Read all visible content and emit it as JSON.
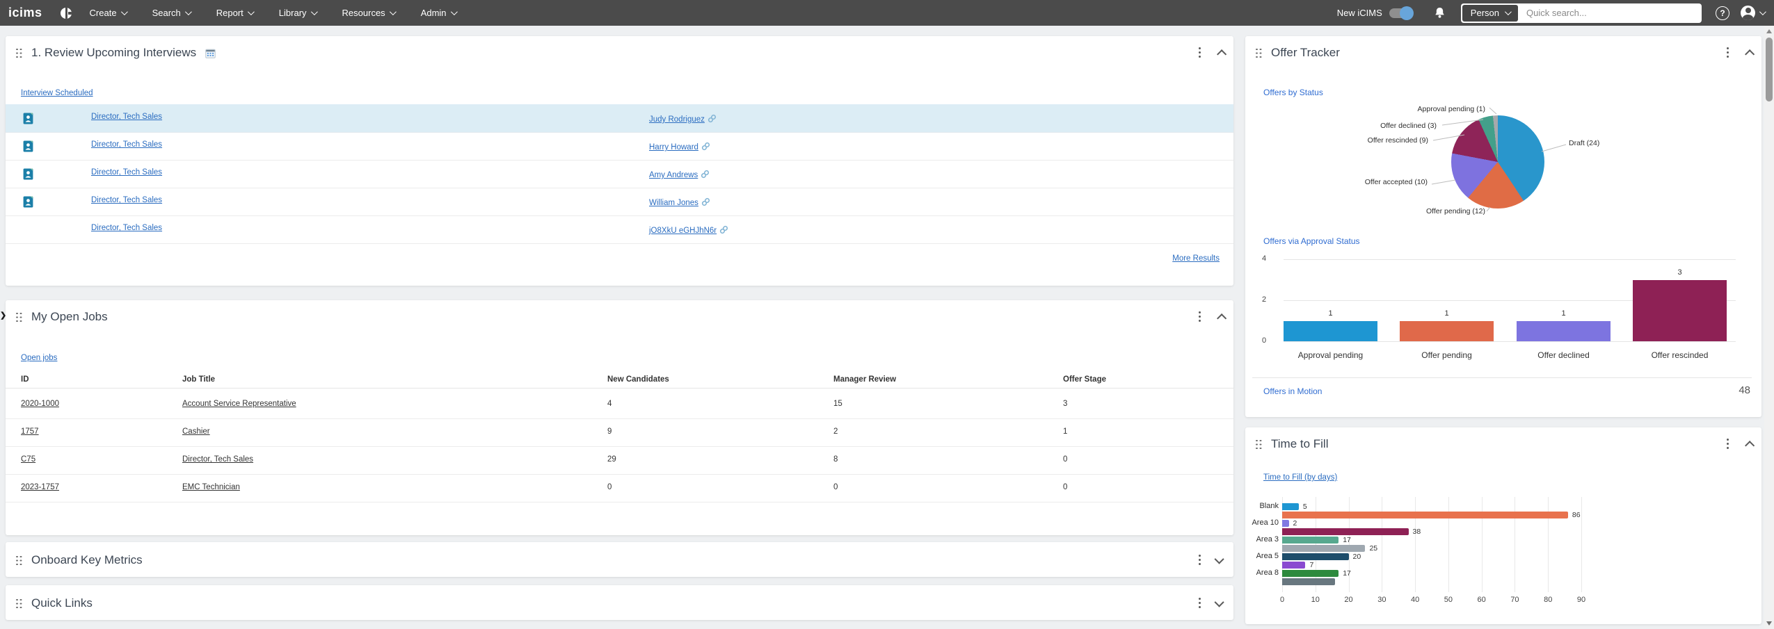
{
  "navbar": {
    "logo": "icims",
    "menus": [
      {
        "label": "Create"
      },
      {
        "label": "Search"
      },
      {
        "label": "Report"
      },
      {
        "label": "Library"
      },
      {
        "label": "Resources"
      },
      {
        "label": "Admin"
      }
    ],
    "new_icims_label": "New iCIMS",
    "search_scope": "Person",
    "search_placeholder": "Quick search...",
    "help_glyph": "?"
  },
  "widgets": {
    "interviews": {
      "title": "1. Review Upcoming Interviews",
      "title_icon": "calendar-icon",
      "link": "Interview Scheduled",
      "rows": [
        {
          "job": "Director, Tech Sales",
          "person": "Judy Rodriguez",
          "doc": true,
          "highlight": true
        },
        {
          "job": "Director, Tech Sales",
          "person": "Harry Howard",
          "doc": true,
          "highlight": false
        },
        {
          "job": "Director, Tech Sales",
          "person": "Amy Andrews",
          "doc": true,
          "highlight": false
        },
        {
          "job": "Director, Tech Sales",
          "person": "William Jones",
          "doc": true,
          "highlight": false
        },
        {
          "job": "Director, Tech Sales",
          "person": "jO8XkU eGHJhN6r",
          "doc": false,
          "highlight": false
        }
      ],
      "more_link": "More Results"
    },
    "open_jobs": {
      "title": "My Open Jobs",
      "link": "Open jobs",
      "columns": [
        "ID",
        "Job Title",
        "New Candidates",
        "Manager Review",
        "Offer Stage"
      ],
      "rows": [
        [
          "2020-1000",
          "Account Service Representative",
          "4",
          "15",
          "3"
        ],
        [
          "1757",
          "Cashier",
          "9",
          "2",
          "1"
        ],
        [
          "C75",
          "Director, Tech Sales",
          "29",
          "8",
          "0"
        ],
        [
          "2023-1757",
          "EMC Technician",
          "0",
          "0",
          "0"
        ]
      ]
    },
    "onboard": {
      "title": "Onboard Key Metrics"
    },
    "quick_links": {
      "title": "Quick Links"
    },
    "offer_tracker": {
      "title": "Offer Tracker",
      "pie_link": "Offers by Status",
      "bar_link": "Offers via Approval Status",
      "motion_link": "Offers in Motion",
      "motion_value": "48"
    },
    "time_to_fill": {
      "title": "Time to Fill",
      "link": "Time to Fill (by days)"
    }
  },
  "chart_data": [
    {
      "id": "offers_by_status",
      "type": "pie",
      "title": "Offers by Status",
      "labels": [
        "Draft",
        "Offer pending",
        "Offer accepted",
        "Offer rescinded",
        "Offer declined",
        "Approval pending"
      ],
      "values": [
        24,
        12,
        10,
        9,
        3,
        1
      ],
      "label_texts": [
        "Draft (24)",
        "Offer pending (12)",
        "Offer accepted (10)",
        "Offer rescinded (9)",
        "Offer declined (3)",
        "Approval pending (1)"
      ],
      "colors": [
        "#2996cc",
        "#e06c45",
        "#7e72df",
        "#8e2458",
        "#43a08a",
        "#a7a9ac"
      ],
      "legend_position": "outside-callouts"
    },
    {
      "id": "offers_via_approval_status",
      "type": "bar",
      "title": "Offers via Approval Status",
      "categories": [
        "Approval pending",
        "Offer pending",
        "Offer declined",
        "Offer rescinded"
      ],
      "values": [
        1,
        1,
        1,
        3
      ],
      "value_labels": [
        "1",
        "1",
        "1",
        "3"
      ],
      "colors": [
        "#1e96d2",
        "#e0694a",
        "#7d74e0",
        "#8e2155"
      ],
      "ylim": [
        0,
        4
      ],
      "yticks": [
        0,
        2,
        4
      ],
      "grid": true
    },
    {
      "id": "time_to_fill_by_days",
      "type": "bar",
      "orientation": "horizontal",
      "title": "Time to Fill (by days)",
      "categories": [
        "Blank",
        "Area 10",
        "Area 3",
        "Area 5",
        "Area 8"
      ],
      "bars_per_category": 2,
      "values": [
        5,
        86,
        2,
        38,
        17,
        25,
        20,
        7,
        17,
        16
      ],
      "value_labels": [
        "5",
        "86",
        "2",
        "38",
        "17",
        "25",
        "20",
        "7",
        "17",
        ""
      ],
      "colors": [
        "#1e96d2",
        "#e8724d",
        "#8078e2",
        "#8e2155",
        "#57a88f",
        "#9fa8b0",
        "#1d4d6b",
        "#8a4ad0",
        "#2e8a3e",
        "#68777f"
      ],
      "xlim": [
        0,
        90
      ],
      "xticks": [
        0,
        10,
        20,
        30,
        40,
        50,
        60,
        70,
        80,
        90
      ],
      "grid": true
    }
  ]
}
